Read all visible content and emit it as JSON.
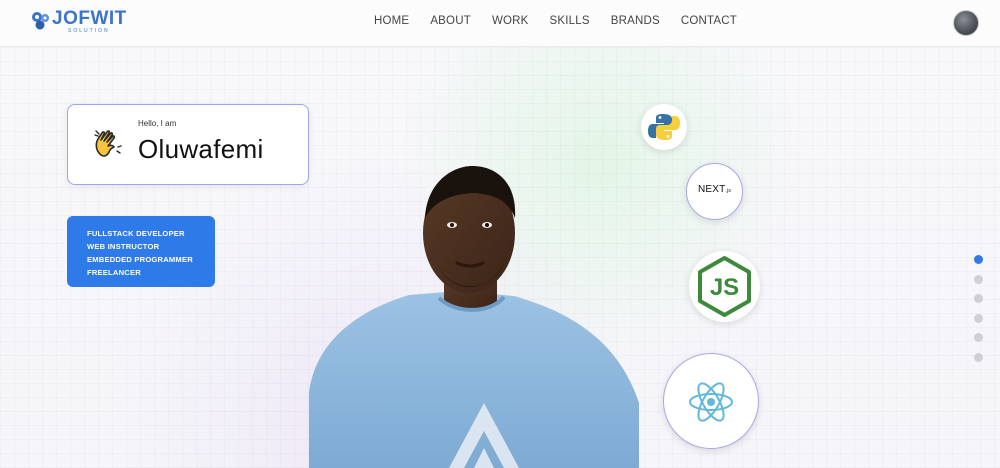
{
  "brand": {
    "logo_text": "JOFWIT",
    "logo_sub": "SOLUTION"
  },
  "nav": {
    "links": [
      {
        "label": "HOME"
      },
      {
        "label": "ABOUT"
      },
      {
        "label": "WORK"
      },
      {
        "label": "SKILLS"
      },
      {
        "label": "BRANDS"
      },
      {
        "label": "CONTACT"
      }
    ]
  },
  "hero": {
    "greeting": "Hello, I am",
    "name": "Oluwafemi",
    "roles": [
      "FULLSTACK DEVELOPER",
      "WEB INSTRUCTOR",
      "EMBEDDED PROGRAMMER",
      "FREELANCER"
    ]
  },
  "tech_icons": {
    "python": "python-icon",
    "next": {
      "label": "NEXT",
      "suffix": ".js"
    },
    "node": "nodejs-icon",
    "react": "react-icon"
  },
  "section_dots": {
    "count": 6,
    "active_index": 0
  },
  "colors": {
    "accent": "#2d7ae8",
    "logo": "#3b74c9",
    "card_border": "#9fa5e8"
  }
}
